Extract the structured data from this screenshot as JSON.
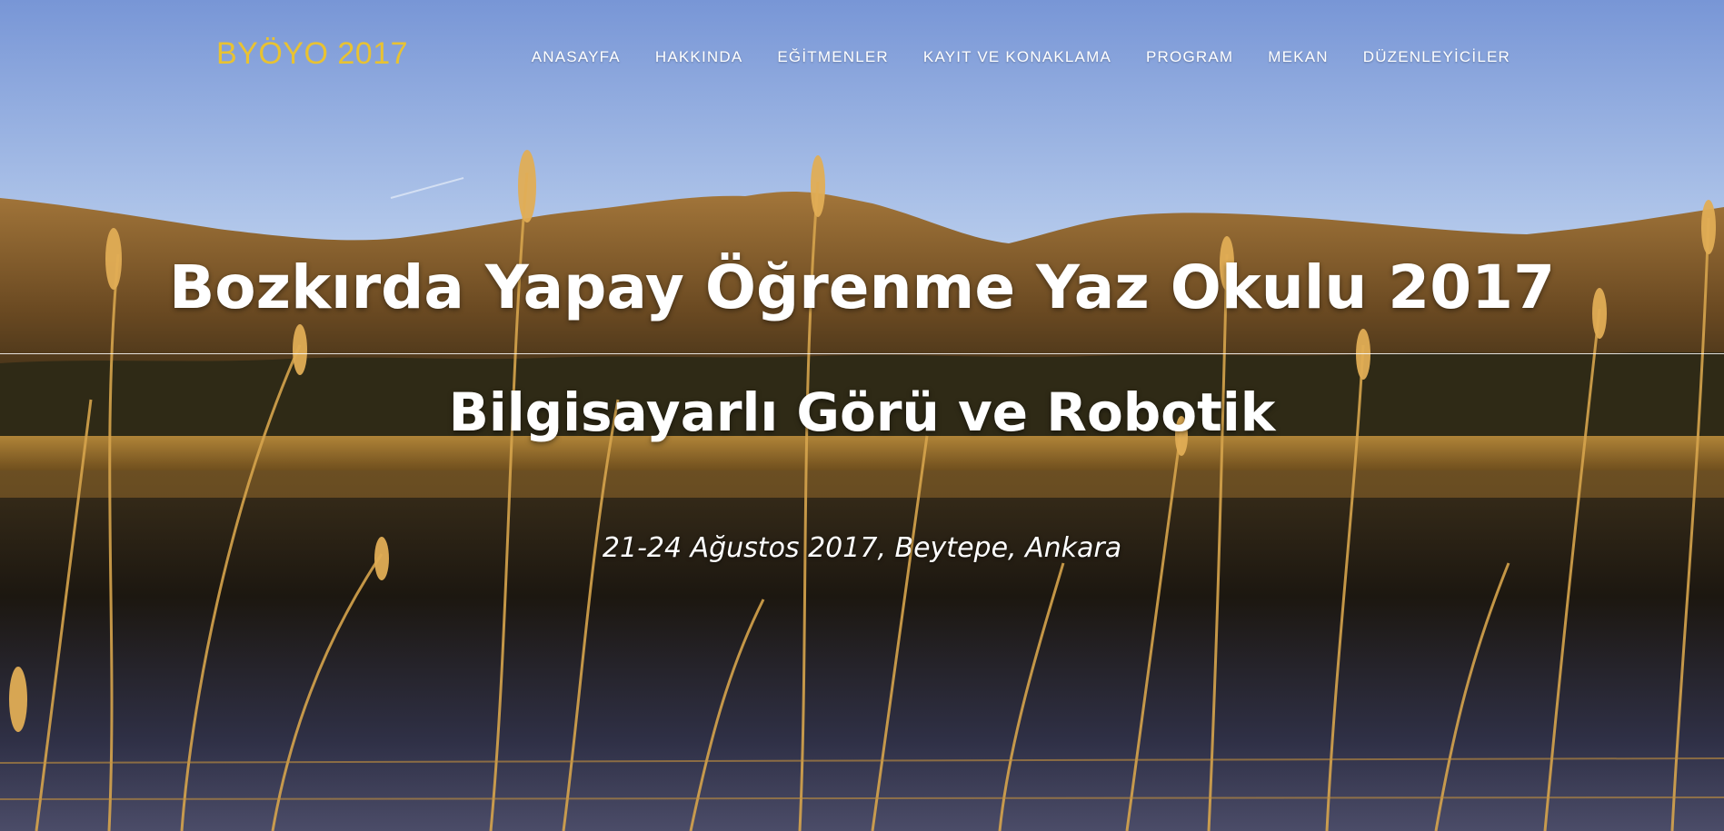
{
  "brand": {
    "label": "BYÖYO 2017",
    "color": "#e8c232"
  },
  "nav": {
    "items": [
      {
        "label": "ANASAYFA"
      },
      {
        "label": "HAKKINDA"
      },
      {
        "label": "EĞİTMENLER"
      },
      {
        "label": "KAYIT VE KONAKLAMA"
      },
      {
        "label": "PROGRAM"
      },
      {
        "label": "MEKAN"
      },
      {
        "label": "DÜZENLEYİCİLER"
      }
    ]
  },
  "hero": {
    "title": "Bozkırda Yapay Öğrenme Yaz Okulu 2017",
    "subtitle": "Bilgisayarlı Görü ve Robotik",
    "dateline": "21-24 Ağustos 2017, Beytepe, Ankara"
  },
  "colors": {
    "sky_top": "#7d9bd8",
    "sky_bottom": "#b8cdec",
    "hills": "#7a5a2a",
    "water": "#2a2418",
    "reeds": "#d4a24a"
  }
}
